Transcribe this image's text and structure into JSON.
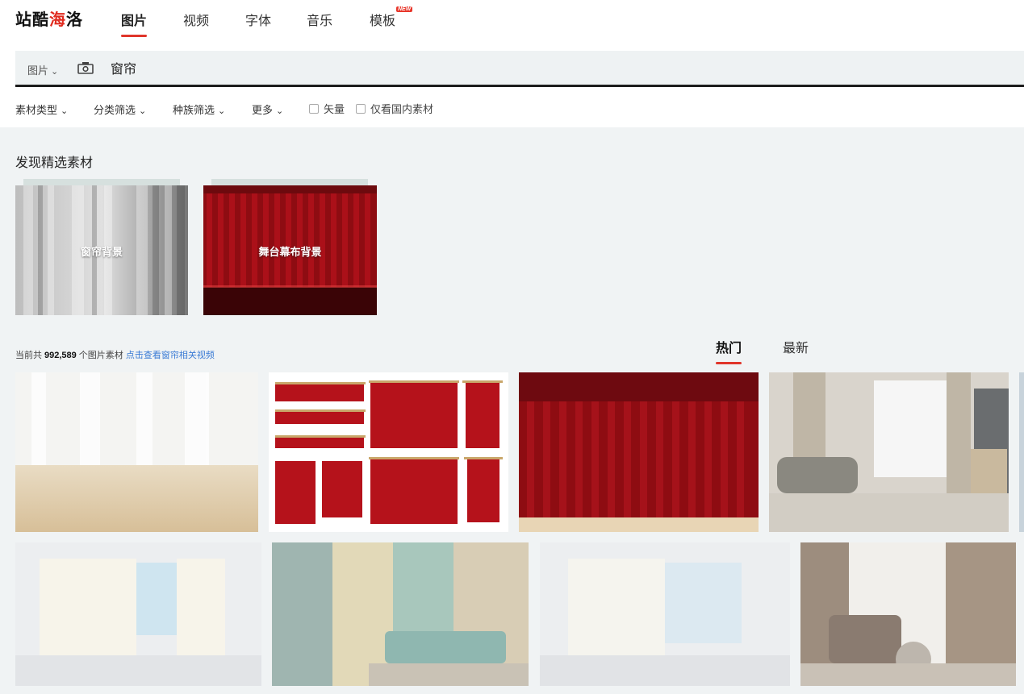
{
  "logo": {
    "text_black": "站酷",
    "text_red": "海",
    "text_black2": "洛"
  },
  "nav": {
    "tabs": [
      {
        "label": "图片",
        "active": true
      },
      {
        "label": "视频"
      },
      {
        "label": "字体"
      },
      {
        "label": "音乐"
      },
      {
        "label": "模板",
        "badge": "NEW"
      }
    ]
  },
  "search": {
    "type_label": "图片",
    "query": "窗帘",
    "camera_icon": "camera-icon"
  },
  "filters": {
    "dropdowns": [
      "素材类型",
      "分类筛选",
      "种族筛选",
      "更多"
    ],
    "checkboxes": [
      "矢量",
      "仅看国内素材"
    ]
  },
  "featured": {
    "title": "发现精选素材",
    "cards": [
      {
        "label": "窗帘背景"
      },
      {
        "label": "舞台幕布背景"
      }
    ]
  },
  "results": {
    "count_prefix": "当前共",
    "count": "992,589",
    "count_suffix": "个图片素材",
    "video_link": "点击查看窗帘相关视频",
    "sort_tabs": [
      {
        "label": "热门",
        "active": true
      },
      {
        "label": "最新"
      }
    ]
  },
  "colors": {
    "accent": "#e0352a",
    "link": "#3a7bd5",
    "curtain_red": "#9b0f16"
  }
}
